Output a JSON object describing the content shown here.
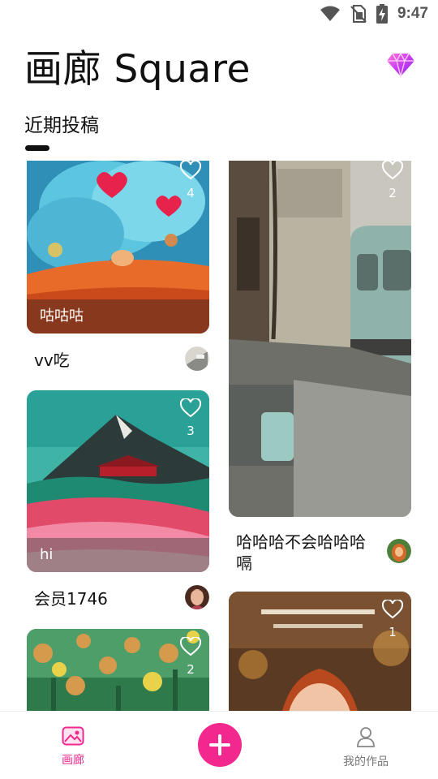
{
  "status_bar": {
    "time": "9:47",
    "icons": [
      "wifi-icon",
      "no-sim-icon",
      "battery-charging-icon"
    ]
  },
  "header": {
    "title": "画廊 Square",
    "vip_icon": "diamond-icon"
  },
  "section": {
    "title": "近期投稿"
  },
  "colors": {
    "accent": "#f2288f",
    "nav_inactive": "#777777",
    "text": "#111111"
  },
  "gallery": {
    "left_column": [
      {
        "caption": "咕咕咕",
        "likes": "4",
        "author": "vv吃"
      },
      {
        "caption": "hi",
        "likes": "3",
        "author": "会员1746"
      },
      {
        "caption": "",
        "likes": "2",
        "author": ""
      }
    ],
    "right_column": [
      {
        "caption": "",
        "likes": "2",
        "author": "哈哈哈不会哈哈哈嗝"
      },
      {
        "caption": "",
        "likes": "1",
        "author": ""
      }
    ]
  },
  "bottom_nav": {
    "items": [
      {
        "label": "画廊",
        "icon": "gallery-icon",
        "active": true
      },
      {
        "label": "我的作品",
        "icon": "person-icon",
        "active": false
      }
    ],
    "fab_icon": "plus-icon"
  }
}
